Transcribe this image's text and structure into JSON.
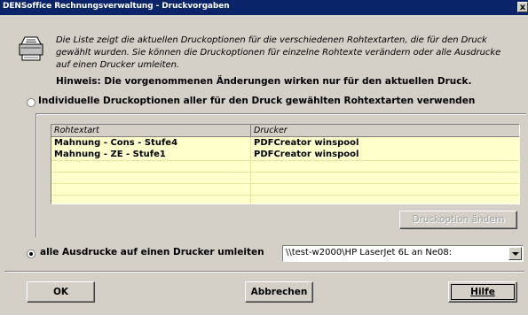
{
  "window": {
    "title": "DENSoffice Rechnungsverwaltung - Druckvorgaben",
    "close_glyph": "x"
  },
  "info": {
    "line1": "Die Liste zeigt die aktuellen Druckoptionen für die verschiedenen Rohtextarten, die für den Druck",
    "line2": "gewählt wurden. Sie können die Druckoptionen für einzelne Rohtexte verändern oder alle Ausdrucke",
    "line3": "auf einen Drucker umleiten.",
    "hint": "Hinweis: Die vorgenommenen Änderungen wirken nur für den aktuellen Druck.",
    "icon": "printer-icon"
  },
  "option_individual": {
    "label": "Individuelle Druckoptionen aller für den Druck gewählten Rohtextarten verwenden",
    "selected": false
  },
  "table": {
    "columns": [
      "Rohtextart",
      "Drucker"
    ],
    "rows": [
      [
        "Mahnung - Cons - Stufe4",
        "PDFCreator winspool"
      ],
      [
        "Mahnung - ZE - Stufe1",
        "PDFCreator winspool"
      ]
    ],
    "empty_row_count": 4
  },
  "buttons": {
    "change_option": "Druckoption ändern",
    "ok": "OK",
    "cancel": "Abbrechen",
    "help": "Hilfe"
  },
  "option_redirect": {
    "label": "alle Ausdrucke auf einen Drucker umleiten",
    "selected": true,
    "printer_value": "\\\\test-w2000\\HP LaserJet 6L an Ne08:"
  },
  "colors": {
    "titlebar": "#0a246a",
    "dialog_bg": "#d4d0c8",
    "list_bg": "#ffffcc"
  }
}
